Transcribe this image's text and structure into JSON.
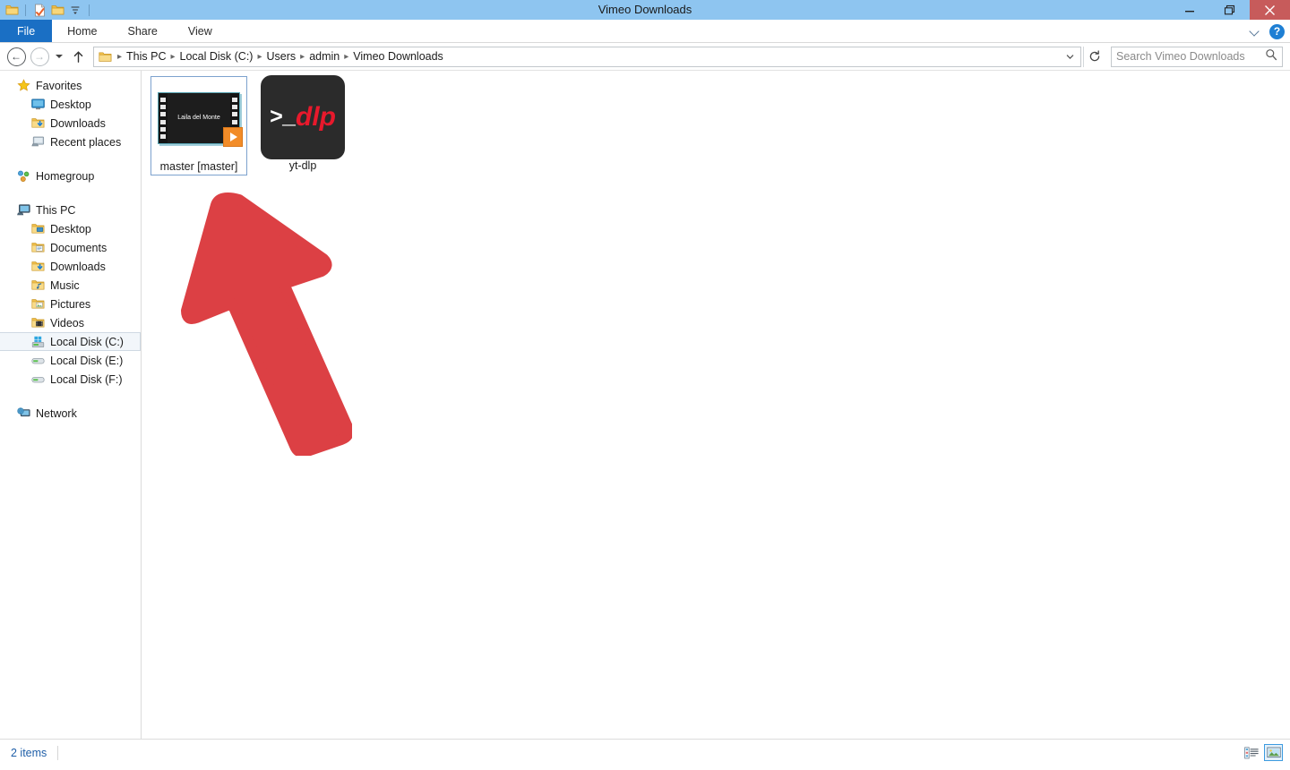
{
  "window": {
    "title": "Vimeo Downloads",
    "accent_titlebar": "#8EC5F0",
    "close_color": "#C75B5B"
  },
  "quick_access": {
    "items": [
      {
        "name": "folder-icon",
        "label": "Folder"
      },
      {
        "name": "properties-icon",
        "label": "Properties"
      },
      {
        "name": "new-folder-icon",
        "label": "New folder"
      },
      {
        "name": "customize-qat-icon",
        "label": "Customize Quick Access Toolbar"
      }
    ]
  },
  "window_controls": {
    "minimize": "Minimize",
    "restore": "Restore",
    "close": "Close"
  },
  "ribbon": {
    "tabs": [
      {
        "label": "File",
        "active": true
      },
      {
        "label": "Home",
        "active": false
      },
      {
        "label": "Share",
        "active": false
      },
      {
        "label": "View",
        "active": false
      }
    ],
    "expand_label": "Expand the Ribbon",
    "help_label": "?"
  },
  "address": {
    "back_label": "Back",
    "forward_label": "Forward",
    "recent_label": "Recent locations",
    "up_label": "Up",
    "refresh_label": "Refresh",
    "crumbs": [
      "This PC",
      "Local Disk (C:)",
      "Users",
      "admin",
      "Vimeo Downloads"
    ],
    "separator": "▸",
    "dropdown": "⌄"
  },
  "search": {
    "placeholder": "Search Vimeo Downloads",
    "value": ""
  },
  "sidebar": {
    "groups": [
      {
        "header": {
          "label": "Favorites",
          "icon": "star-icon"
        },
        "items": [
          {
            "label": "Desktop",
            "icon": "desktop-icon"
          },
          {
            "label": "Downloads",
            "icon": "downloads-folder-icon"
          },
          {
            "label": "Recent places",
            "icon": "recent-places-icon"
          }
        ]
      },
      {
        "header": {
          "label": "Homegroup",
          "icon": "homegroup-icon"
        },
        "items": []
      },
      {
        "header": {
          "label": "This PC",
          "icon": "this-pc-icon"
        },
        "items": [
          {
            "label": "Desktop",
            "icon": "desktop-folder-icon"
          },
          {
            "label": "Documents",
            "icon": "documents-folder-icon"
          },
          {
            "label": "Downloads",
            "icon": "downloads-folder-icon"
          },
          {
            "label": "Music",
            "icon": "music-folder-icon"
          },
          {
            "label": "Pictures",
            "icon": "pictures-folder-icon"
          },
          {
            "label": "Videos",
            "icon": "videos-folder-icon"
          },
          {
            "label": "Local Disk (C:)",
            "icon": "system-drive-icon",
            "selected": true
          },
          {
            "label": "Local Disk (E:)",
            "icon": "drive-icon"
          },
          {
            "label": "Local Disk (F:)",
            "icon": "drive-icon"
          }
        ]
      },
      {
        "header": {
          "label": "Network",
          "icon": "network-icon"
        },
        "items": []
      }
    ]
  },
  "files": [
    {
      "name": "master [master]",
      "icon": "video-thumbnail-icon",
      "thumbnail_title": "Laila del Monte",
      "selected": true
    },
    {
      "name": "yt-dlp",
      "icon": "yt-dlp-app-icon",
      "icon_prompt": ">_",
      "icon_word": "dlp",
      "selected": false
    }
  ],
  "annotation": {
    "type": "arrow",
    "color": "#DC4044",
    "points_to": "master [master]"
  },
  "status": {
    "item_count": "2 items",
    "views": [
      {
        "name": "details-view-icon",
        "label": "Details view",
        "active": false
      },
      {
        "name": "large-icons-view-icon",
        "label": "Large icons view",
        "active": true
      }
    ]
  }
}
